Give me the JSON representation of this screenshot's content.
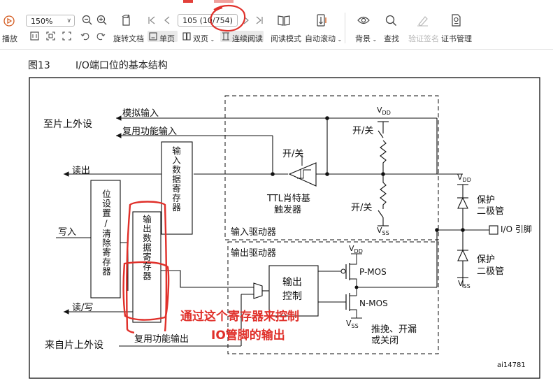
{
  "toolbar": {
    "play_label": "播放",
    "zoom": "150%",
    "page": "105 (10",
    "page_tail": "/754)",
    "rotate_label": "旋转文档",
    "single_page": "单页",
    "double_page": "双页",
    "continuous": "连续阅读",
    "read_mode": "阅读模式",
    "auto_scroll": "自动滚动",
    "background": "背景",
    "find": "查找",
    "verify_sign": "验证签名",
    "cert_manage": "证书管理"
  },
  "figure": {
    "caption_num": "图13",
    "caption_text": "I/O端口位的基本结构",
    "to_periph": "至片上外设",
    "from_periph": "来自片上外设",
    "analog_in": "模拟输入",
    "alt_in": "复用功能输入",
    "read": "读出",
    "write": "写入",
    "read_write": "读/写",
    "alt_out": "复用功能输出",
    "input_data_reg": "输入数据寄存器",
    "bsr_reg": "位设置/清除寄存器",
    "output_data_reg": "输出数据寄存器",
    "on_off": "开/关",
    "ttl_1": "TTL肖特基",
    "ttl_2": "触发器",
    "input_driver": "输入驱动器",
    "output_driver": "输出驱动器",
    "out_ctrl_1": "输出",
    "out_ctrl_2": "控制",
    "pmos": "P-MOS",
    "nmos": "N-MOS",
    "pp_1": "推挽、开漏",
    "pp_2": "或关闭",
    "protect": "保护",
    "diode": "二极管",
    "io_pin": "I/O 引脚",
    "vdd": "V",
    "vdd_sub": "DD",
    "vss_sub": "SS",
    "fig_id": "ai14781"
  },
  "annotation": {
    "line1": "通过这个寄存器来控制",
    "line2": "IO管脚的输出",
    "color": "#e0302a"
  }
}
